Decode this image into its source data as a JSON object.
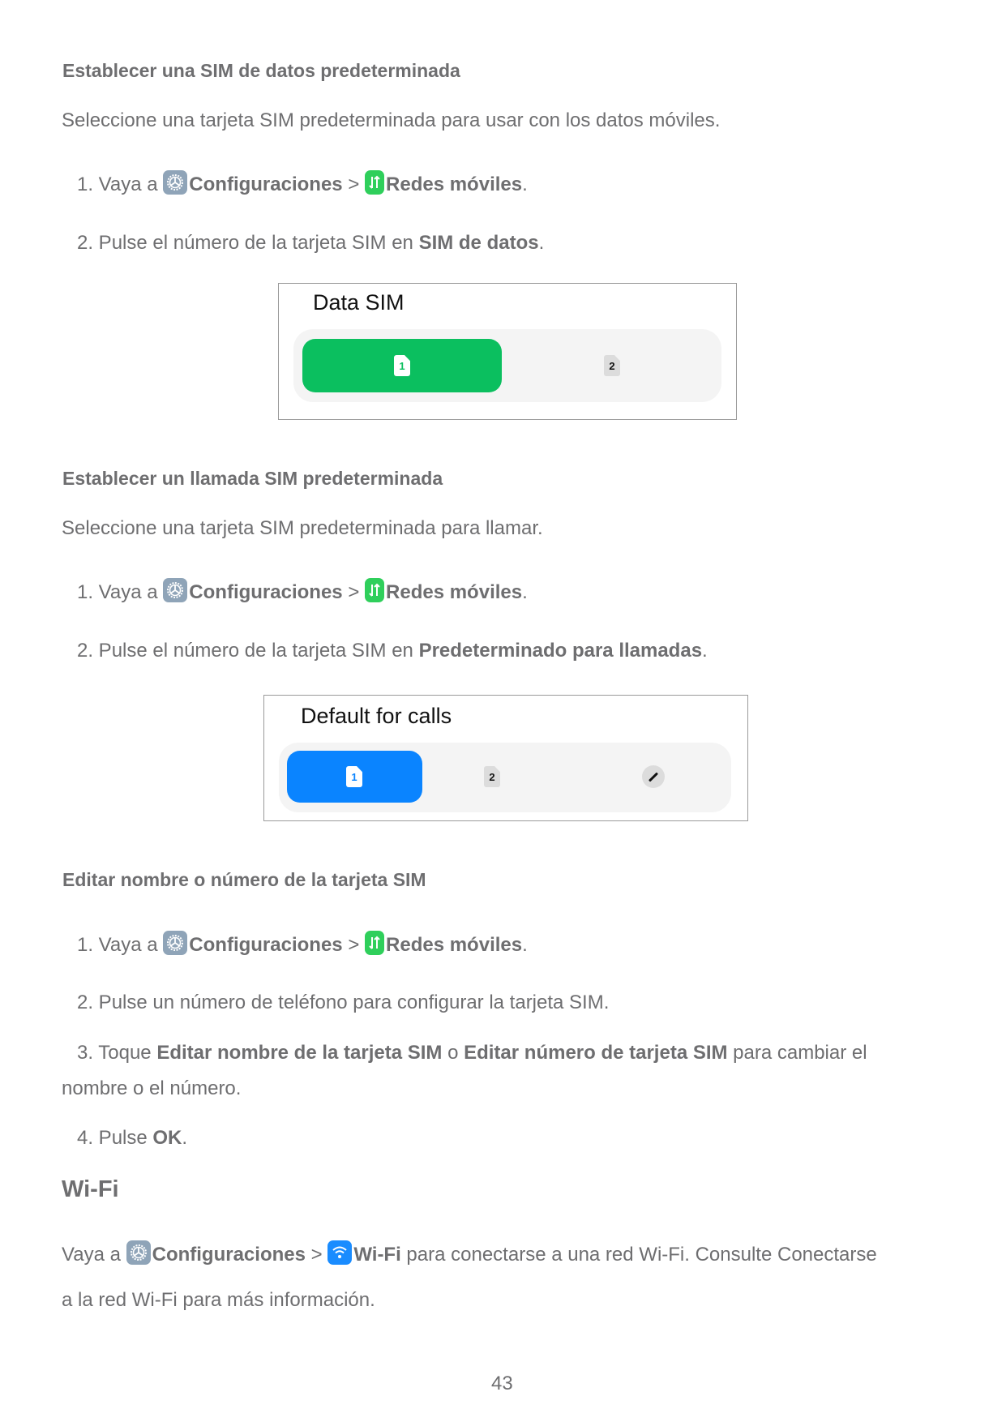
{
  "section_data_sim": {
    "heading": "Establecer una SIM de datos predeterminada",
    "intro": "Seleccione una tarjeta SIM predeterminada para usar con los datos móviles.",
    "step1": {
      "prefix": "1. Vaya a ",
      "settings": "Configuraciones",
      "sep": " > ",
      "target": "Redes móviles",
      "suffix": "."
    },
    "step2": {
      "prefix": "2. Pulse el número de la tarjeta SIM en ",
      "bold": "SIM de datos",
      "suffix": "."
    },
    "widget": {
      "title": "Data SIM",
      "options": [
        {
          "label": "1",
          "selected": true
        },
        {
          "label": "2",
          "selected": false
        }
      ],
      "accent": "#0bbf5f"
    }
  },
  "section_call_sim": {
    "heading": "Establecer un llamada SIM predeterminada",
    "intro": "Seleccione una tarjeta SIM predeterminada para llamar.",
    "step1": {
      "prefix": "1. Vaya a ",
      "settings": "Configuraciones",
      "sep": " > ",
      "target": "Redes móviles",
      "suffix": "."
    },
    "step2": {
      "prefix": "2. Pulse el número de la tarjeta SIM en ",
      "bold": "Predeterminado para llamadas",
      "suffix": "."
    },
    "widget": {
      "title": "Default for calls",
      "options": [
        {
          "label": "1",
          "selected": true
        },
        {
          "label": "2",
          "selected": false
        },
        {
          "label": "edit-icon",
          "selected": false
        }
      ],
      "accent": "#0a84ff"
    }
  },
  "section_edit_sim": {
    "heading": "Editar nombre o número de la tarjeta SIM",
    "step1": {
      "prefix": "1. Vaya a ",
      "settings": "Configuraciones",
      "sep": " > ",
      "target": "Redes móviles",
      "suffix": "."
    },
    "step2": "2. Pulse un número de teléfono para configurar la tarjeta SIM.",
    "step3": {
      "prefix": "3. Toque ",
      "bold1": "Editar nombre de la tarjeta SIM",
      "mid": " o ",
      "bold2": "Editar número de tarjeta SIM",
      "suffix": " para cambiar el",
      "line2": "nombre o el número."
    },
    "step4": {
      "prefix": "4. Pulse ",
      "bold": "OK",
      "suffix": "."
    }
  },
  "section_wifi": {
    "heading": "Wi-Fi",
    "line1": {
      "prefix": "Vaya a ",
      "settings": "Configuraciones",
      "sep": " > ",
      "target": "Wi-Fi",
      "suffix": " para conectarse a una red Wi-Fi. Consulte Conectarse"
    },
    "line2": "a la red Wi-Fi para más información."
  },
  "page_number": "43",
  "icons": {
    "settings": "gear-icon",
    "mobile_networks": "mobile-data-arrows-icon",
    "wifi": "wifi-icon"
  },
  "colors": {
    "text": "#6e6e70",
    "settings_icon": "#8fa4b8",
    "mobile_icon": "#2fcf5b",
    "wifi_icon": "#1a8cff"
  }
}
